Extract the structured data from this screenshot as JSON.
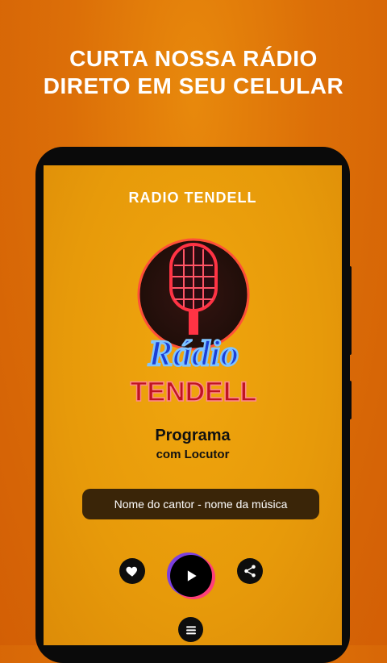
{
  "promo": {
    "line1": "CURTA NOSSA RÁDIO",
    "line2": "DIRETO EM SEU CELULAR"
  },
  "app": {
    "title": "RADIO TENDELL",
    "logo": {
      "script_text": "Rádio",
      "block_text": "TENDELL",
      "icon": "microphone-icon"
    },
    "program": "Programa",
    "host": "com Locutor",
    "now_playing": "Nome do cantor - nome da música",
    "controls": {
      "favorite_icon": "heart-icon",
      "play_icon": "play-icon",
      "share_icon": "share-icon",
      "menu_icon": "menu-icon"
    }
  },
  "colors": {
    "background": "#dc6f08",
    "screen": "#e79a0a",
    "now_playing_bg": "#3a2508",
    "accent_purple": "#7b3fe0",
    "accent_pink": "#ff3f7a"
  }
}
